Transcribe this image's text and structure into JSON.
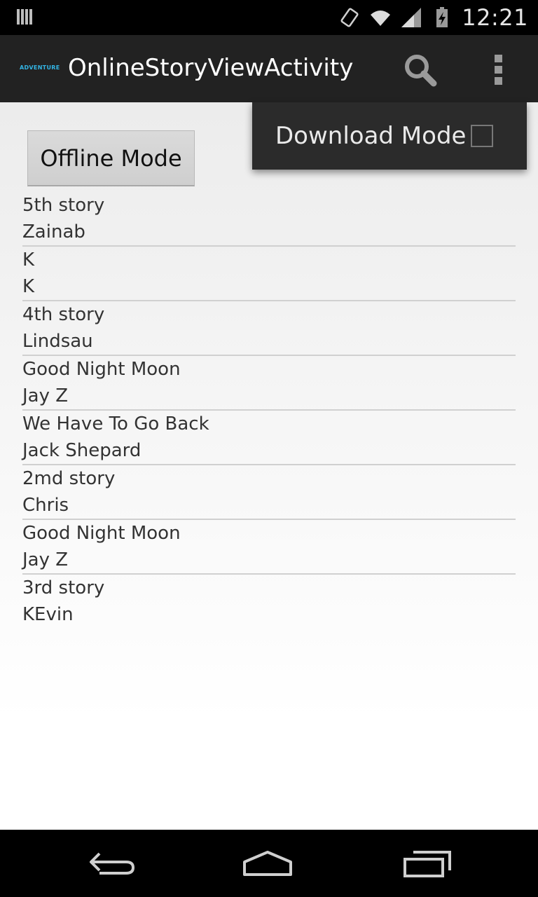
{
  "status_bar": {
    "time": "12:21",
    "icons": [
      "notification-icon",
      "vibrate-icon",
      "wifi-icon",
      "signal-icon",
      "battery-charging-icon"
    ]
  },
  "action_bar": {
    "logo_text": "ADVENTURE",
    "title": "OnlineStoryViewActivity",
    "icons": [
      "search-icon",
      "overflow-menu-icon"
    ]
  },
  "content": {
    "offline_button_label": "Offline Mode",
    "stories": [
      {
        "title": "5th story",
        "author": "Zainab"
      },
      {
        "title": "K",
        "author": "K"
      },
      {
        "title": "4th story",
        "author": "Lindsau"
      },
      {
        "title": "Good Night Moon",
        "author": "Jay Z"
      },
      {
        "title": "We Have To Go Back",
        "author": "Jack Shepard"
      },
      {
        "title": "2md story",
        "author": "Chris"
      },
      {
        "title": "Good Night Moon",
        "author": "Jay Z"
      },
      {
        "title": "3rd story",
        "author": "KEvin"
      }
    ]
  },
  "popup_menu": {
    "items": [
      {
        "label": "Download Mode",
        "checked": false
      }
    ]
  },
  "nav_bar": {
    "icons": [
      "back-icon",
      "home-icon",
      "recent-apps-icon"
    ]
  },
  "colors": {
    "action_bar": "#222222",
    "accent": "#33b5e5",
    "popup_bg": "#2b2b2b"
  }
}
